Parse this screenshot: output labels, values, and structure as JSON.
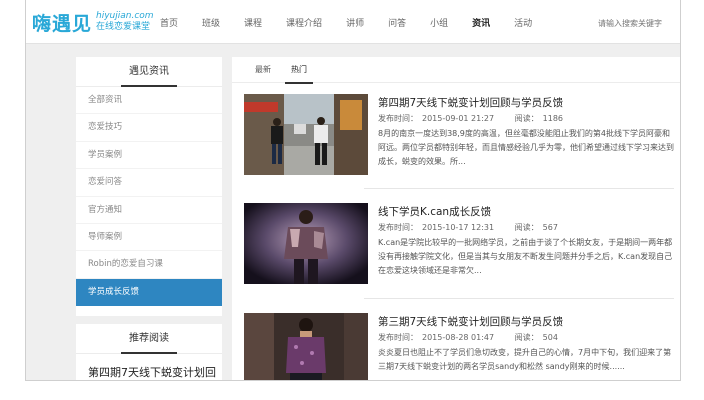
{
  "header": {
    "logo_cn": "嗨遇见",
    "logo_url": "hiyujian.com",
    "logo_tag": "在线恋爱课堂",
    "nav": [
      "首页",
      "班级",
      "课程",
      "课程介绍",
      "讲师",
      "问答",
      "小组",
      "资讯",
      "活动"
    ],
    "active_nav": "资讯",
    "search_placeholder": "请输入搜索关键字"
  },
  "sidebar": {
    "title": "遇见资讯",
    "items": [
      {
        "label": "全部资讯"
      },
      {
        "label": "恋爱技巧"
      },
      {
        "label": "学员案例"
      },
      {
        "label": "恋爱问答"
      },
      {
        "label": "官方通知"
      },
      {
        "label": "导师案例"
      },
      {
        "label": "Robin的恋爱自习课"
      },
      {
        "label": "学员成长反馈"
      }
    ],
    "active_item": "学员成长反馈"
  },
  "recommend": {
    "title": "推荐阅读",
    "item": "第四期7天线下蜕变计划回"
  },
  "tabs": [
    "最新",
    "热门"
  ],
  "active_tab": "热门",
  "meta_labels": {
    "published": "发布时间：",
    "reads": "阅读："
  },
  "articles": [
    {
      "title": "第四期7天线下蜕变计划回顾与学员反馈",
      "date": "2015-09-01 21:27",
      "reads": "1186",
      "excerpt": "8月的南京一度达到38,9度的高温，但丝毫都没能阻止我们的第4批线下学员阿豪和阿远。两位学员都特别年轻，而且情感经验几乎为零，他们希望通过线下学习来达到成长，蜕变的效果。所..."
    },
    {
      "title": "线下学员K.can成长反馈",
      "date": "2015-10-17 12:31",
      "reads": "567",
      "excerpt": "K.can是学院比较早的一批网络学员，之前由于谈了个长期女友，于是期间一两年都没有再接触学院文化，但是当其与女朋友不断发生问题并分手之后，K.can发现自己在恋爱这块领域还是非常欠..."
    },
    {
      "title": "第三期7天线下蜕变计划回顾与学员反馈",
      "date": "2015-08-28 01:47",
      "reads": "504",
      "excerpt": "炎炎夏日也阻止不了学员们急切改变，提升自己的心情，7月中下旬，我们迎来了第三期7天线下蜕变计划的两名学员sandy和松然 sandy刚来的时候......"
    }
  ]
}
